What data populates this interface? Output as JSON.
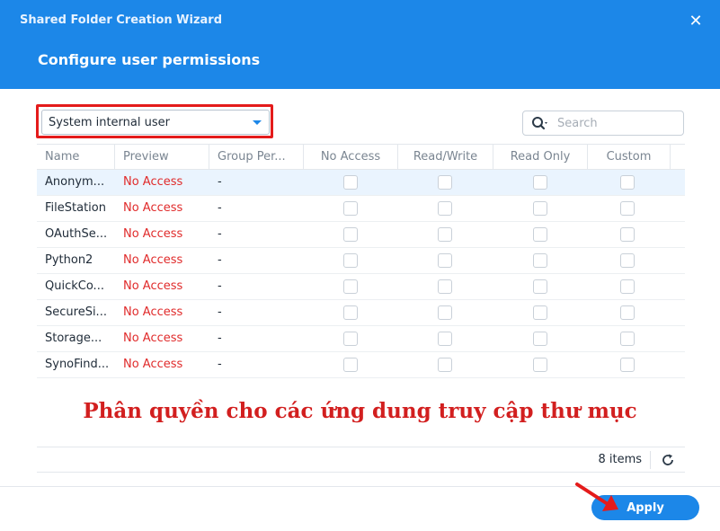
{
  "dialog": {
    "wizard_title": "Shared Folder Creation Wizard",
    "step_title": "Configure user permissions"
  },
  "filter": {
    "selected": "System internal user"
  },
  "search": {
    "placeholder": "Search"
  },
  "table": {
    "columns": [
      "Name",
      "Preview",
      "Group Per...",
      "No Access",
      "Read/Write",
      "Read Only",
      "Custom"
    ],
    "rows": [
      {
        "name": "Anonym...",
        "preview": "No Access",
        "group": "-",
        "no_access": false,
        "read_write": false,
        "read_only": false,
        "custom": false
      },
      {
        "name": "FileStation",
        "preview": "No Access",
        "group": "-",
        "no_access": false,
        "read_write": false,
        "read_only": false,
        "custom": false
      },
      {
        "name": "OAuthSe...",
        "preview": "No Access",
        "group": "-",
        "no_access": false,
        "read_write": false,
        "read_only": false,
        "custom": false
      },
      {
        "name": "Python2",
        "preview": "No Access",
        "group": "-",
        "no_access": false,
        "read_write": false,
        "read_only": false,
        "custom": false
      },
      {
        "name": "QuickCo...",
        "preview": "No Access",
        "group": "-",
        "no_access": false,
        "read_write": false,
        "read_only": false,
        "custom": false
      },
      {
        "name": "SecureSi...",
        "preview": "No Access",
        "group": "-",
        "no_access": false,
        "read_write": false,
        "read_only": false,
        "custom": false
      },
      {
        "name": "Storage...",
        "preview": "No Access",
        "group": "-",
        "no_access": false,
        "read_write": false,
        "read_only": false,
        "custom": false
      },
      {
        "name": "SynoFind...",
        "preview": "No Access",
        "group": "-",
        "no_access": false,
        "read_write": false,
        "read_only": false,
        "custom": false
      }
    ],
    "item_count": "8 items"
  },
  "annotation": "Phân quyền cho các ứng dung truy cập thư mục",
  "footer": {
    "apply_label": "Apply"
  },
  "colors": {
    "header_blue": "#1c87e8",
    "highlight_red": "#e41b1b",
    "no_access_red": "#e02b2b",
    "selected_row": "#eaf4fe"
  },
  "icons": [
    "close-icon",
    "search-icon",
    "refresh-icon",
    "chevron-down-icon",
    "arrow-icon"
  ]
}
